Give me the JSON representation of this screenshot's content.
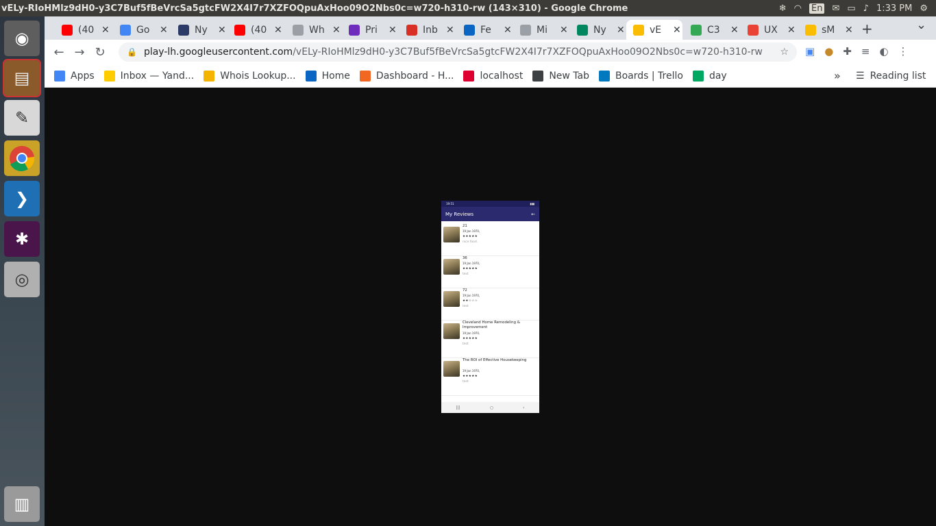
{
  "window": {
    "title": "vELy-RIoHMlz9dH0-y3C7Buf5fBeVrcSa5gtcFW2X4I7r7XZFOQpuAxHoo09O2Nbs0c=w720-h310-rw (143×310) - Google Chrome"
  },
  "system_tray": {
    "lang": "En",
    "time": "1:33 PM"
  },
  "dock": {
    "items": [
      "ubuntu-icon",
      "files-icon",
      "text-editor-icon",
      "chrome-icon",
      "vscode-icon",
      "slack-icon",
      "screenshot-icon",
      "trash-icon"
    ]
  },
  "tabs": [
    {
      "label": "(40",
      "color": "#ff0000"
    },
    {
      "label": "Go",
      "color": "#4285f4"
    },
    {
      "label": "Ny",
      "color": "#2b3a67"
    },
    {
      "label": "(40",
      "color": "#ff0000"
    },
    {
      "label": "Wh",
      "color": "#9aa0a6"
    },
    {
      "label": "Pri",
      "color": "#6f2dbd"
    },
    {
      "label": "Inb",
      "color": "#d93025"
    },
    {
      "label": "Fe",
      "color": "#0a66c2"
    },
    {
      "label": "Mi",
      "color": "#9aa0a6"
    },
    {
      "label": "Ny",
      "color": "#01875f"
    },
    {
      "label": "vE",
      "color": "#fbbc04",
      "active": true
    },
    {
      "label": "C3",
      "color": "#34a853"
    },
    {
      "label": "UX",
      "color": "#ea4335"
    },
    {
      "label": "sM",
      "color": "#fbbc04"
    }
  ],
  "address": {
    "host": "play-lh.googleusercontent.com",
    "path": "/vELy-RIoHMlz9dH0-y3C7Buf5fBeVrcSa5gtcFW2X4I7r7XZFOQpuAxHoo09O2Nbs0c=w720-h310-rw"
  },
  "bookmarks": [
    {
      "label": "Apps",
      "color": "#4285f4"
    },
    {
      "label": "Inbox — Yand...",
      "color": "#ffcc00"
    },
    {
      "label": "Whois Lookup...",
      "color": "#f5b400"
    },
    {
      "label": "Home",
      "color": "#0a66c2"
    },
    {
      "label": "Dashboard - H...",
      "color": "#f26722"
    },
    {
      "label": "localhost",
      "color": "#dd0031"
    },
    {
      "label": "New Tab",
      "color": "#3c4043"
    },
    {
      "label": "Boards | Trello",
      "color": "#0079bf"
    },
    {
      "label": "day",
      "color": "#00a862"
    }
  ],
  "reading_list": "Reading list",
  "phone": {
    "status_time": "19:51",
    "title": "My Reviews",
    "reviews": [
      {
        "title": "21",
        "date": "19 Jan 1970,",
        "stars": "★★★★★",
        "comment": "nice food."
      },
      {
        "title": "36",
        "date": "19 Jan 1970,",
        "stars": "★★★★★",
        "comment": "test"
      },
      {
        "title": "72",
        "date": "19 Jan 1970,",
        "stars": "★★☆☆☆",
        "comment": "test"
      },
      {
        "title": "Cleveland Home Remodeling & Improvement",
        "date": "19 Jan 1970,",
        "stars": "★★★★★",
        "comment": "test"
      },
      {
        "title": "The ROI of Effective Housekeeping",
        "date": "19 Jan 1970,",
        "stars": "★★★★★",
        "comment": "test"
      }
    ]
  }
}
